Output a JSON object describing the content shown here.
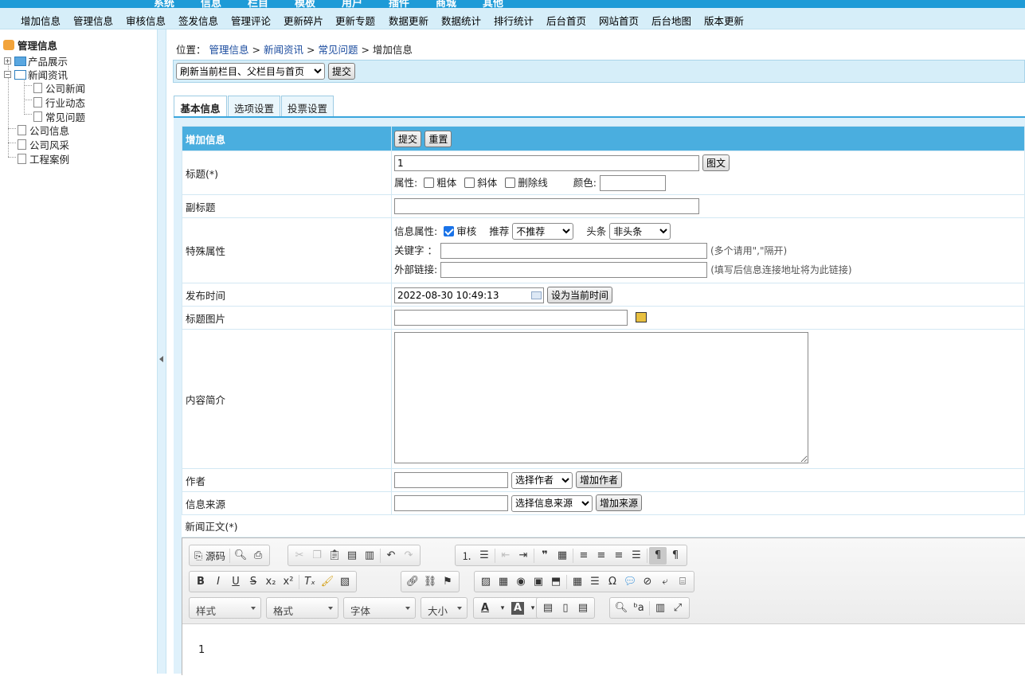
{
  "top_strip": {
    "items": [
      "系统",
      "信息",
      "栏目",
      "模板",
      "用户",
      "插件",
      "商城",
      "其他"
    ]
  },
  "top_menu": {
    "items": [
      "增加信息",
      "管理信息",
      "审核信息",
      "签发信息",
      "管理评论",
      "更新碎片",
      "更新专题",
      "数据更新",
      "数据统计",
      "排行统计",
      "后台首页",
      "网站首页",
      "后台地图",
      "版本更新"
    ]
  },
  "tree": {
    "root": "管理信息",
    "nodes": {
      "products": "产品展示",
      "news": "新闻资讯",
      "company_news": "公司新闻",
      "industry": "行业动态",
      "faq": "常见问题",
      "company_info": "公司信息",
      "company_style": "公司风采",
      "cases": "工程案例"
    }
  },
  "breadcrumb": {
    "prefix": "位置：",
    "items": [
      "管理信息",
      "新闻资讯",
      "常见问题"
    ],
    "sep": ">",
    "current": "增加信息"
  },
  "refresh": {
    "selected": "刷新当前栏目、父栏目与首页",
    "submit": "提交"
  },
  "tabs": [
    "基本信息",
    "选项设置",
    "投票设置"
  ],
  "form": {
    "header": {
      "title": "增加信息",
      "submit": "提交",
      "reset": "重置"
    },
    "title_row": {
      "label": "标题(*)",
      "value": "1",
      "pic_button": "图文",
      "attr_label": "属性:",
      "bold": "粗体",
      "italic": "斜体",
      "strike": "删除线",
      "color_label": "颜色:",
      "color_value": ""
    },
    "subtitle": {
      "label": "副标题",
      "value": ""
    },
    "special": {
      "label": "特殊属性",
      "info_attr": "信息属性:",
      "audit": "审核",
      "recommend_label": "推荐",
      "recommend_value": "不推荐",
      "headline_label": "头条",
      "headline_value": "非头条",
      "keywords_label": "关键字 ：",
      "keywords_hint": "(多个请用\",\"隔开)",
      "link_label": "外部链接:",
      "link_hint": "(填写后信息连接地址将为此链接)"
    },
    "publish_time": {
      "label": "发布时间",
      "value": "2022-08-30 10:49:13",
      "now_button": "设为当前时间"
    },
    "title_pic": {
      "label": "标题图片",
      "value": ""
    },
    "summary": {
      "label": "内容简介",
      "value": ""
    },
    "author": {
      "label": "作者",
      "value": "",
      "select": "选择作者",
      "add": "增加作者"
    },
    "source": {
      "label": "信息来源",
      "value": "",
      "select": "选择信息来源",
      "add": "增加来源"
    },
    "body_label": "新闻正文(*)"
  },
  "editor": {
    "source_label": "源码",
    "combos": {
      "style": "样式",
      "format": "格式",
      "font": "字体",
      "size": "大小"
    },
    "content": "1"
  }
}
